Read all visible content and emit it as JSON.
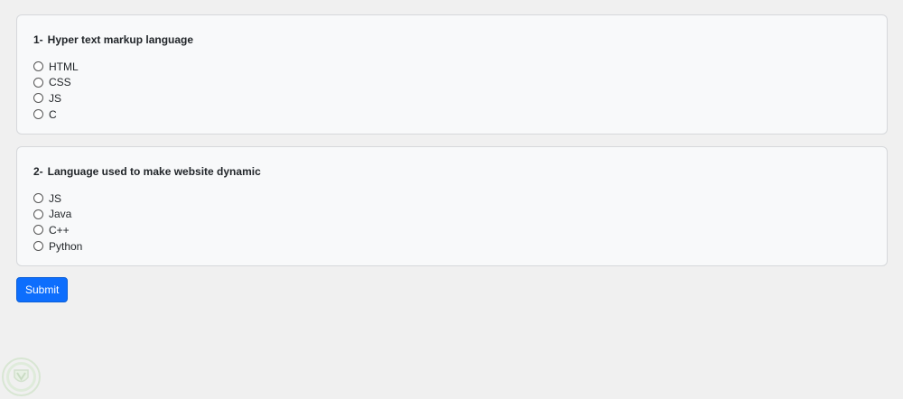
{
  "questions": [
    {
      "number": "1-",
      "title": "Hyper text markup language",
      "options": [
        "HTML",
        "CSS",
        "JS",
        "C"
      ]
    },
    {
      "number": "2-",
      "title": "Language used to make website dynamic",
      "options": [
        "JS",
        "Java",
        "C++",
        "Python"
      ]
    }
  ],
  "submit_label": "Submit",
  "colors": {
    "page_bg": "#f0f0f0",
    "card_bg": "#f8f9fa",
    "button_bg": "#0d6efd"
  },
  "icons": {
    "watermark": "shield-logo-icon"
  }
}
